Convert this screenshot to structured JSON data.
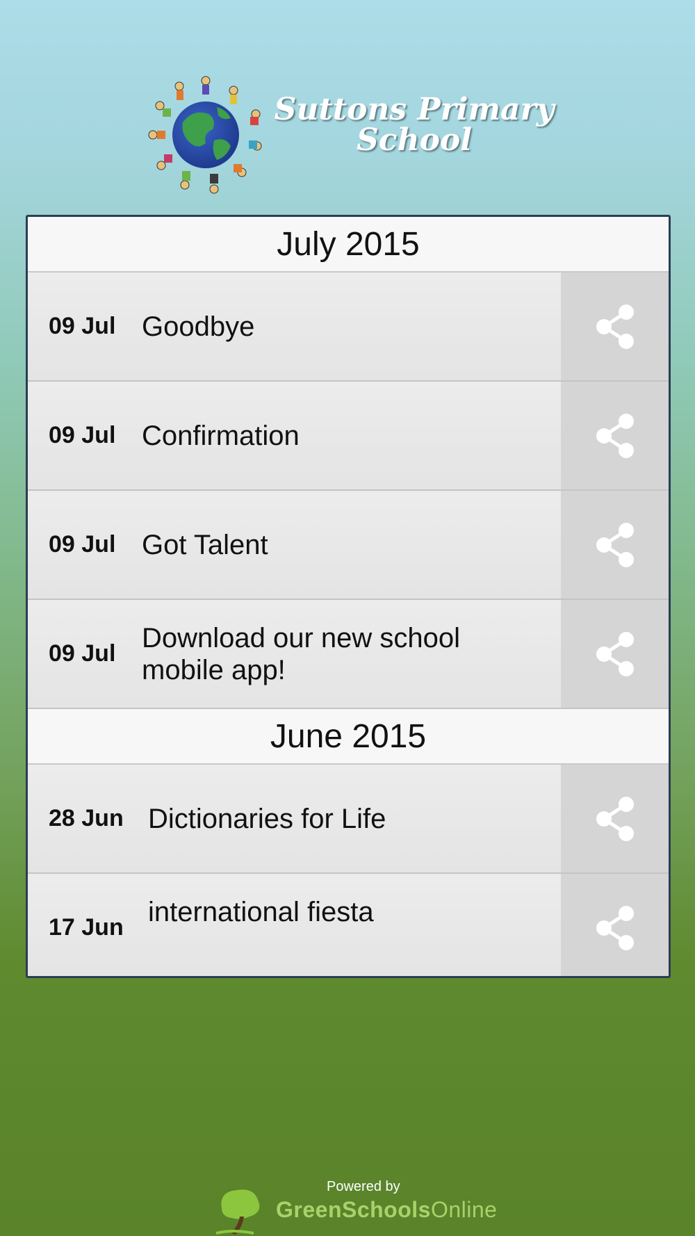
{
  "header": {
    "school_name_line1": "Suttons Primary",
    "school_name_line2": "School"
  },
  "sections": [
    {
      "month": "July 2015",
      "items": [
        {
          "date": "09 Jul",
          "title": "Goodbye"
        },
        {
          "date": "09 Jul",
          "title": "Confirmation"
        },
        {
          "date": "09 Jul",
          "title": "Got Talent"
        },
        {
          "date": "09 Jul",
          "title": "Download our new school mobile app!"
        }
      ]
    },
    {
      "month": "June 2015",
      "items": [
        {
          "date": "28 Jun",
          "title": "Dictionaries for Life"
        },
        {
          "date": "17 Jun",
          "title": "international fiesta"
        }
      ]
    }
  ],
  "footer": {
    "powered_by": "Powered by",
    "brand_bold": "GreenSchools",
    "brand_thin": "Online"
  },
  "colors": {
    "panel_border": "#2b3d55",
    "share_bg": "#d5d5d5",
    "brand_green": "#a8d26a"
  },
  "icons": [
    "globe-children-logo",
    "share-icon",
    "tree-icon"
  ]
}
